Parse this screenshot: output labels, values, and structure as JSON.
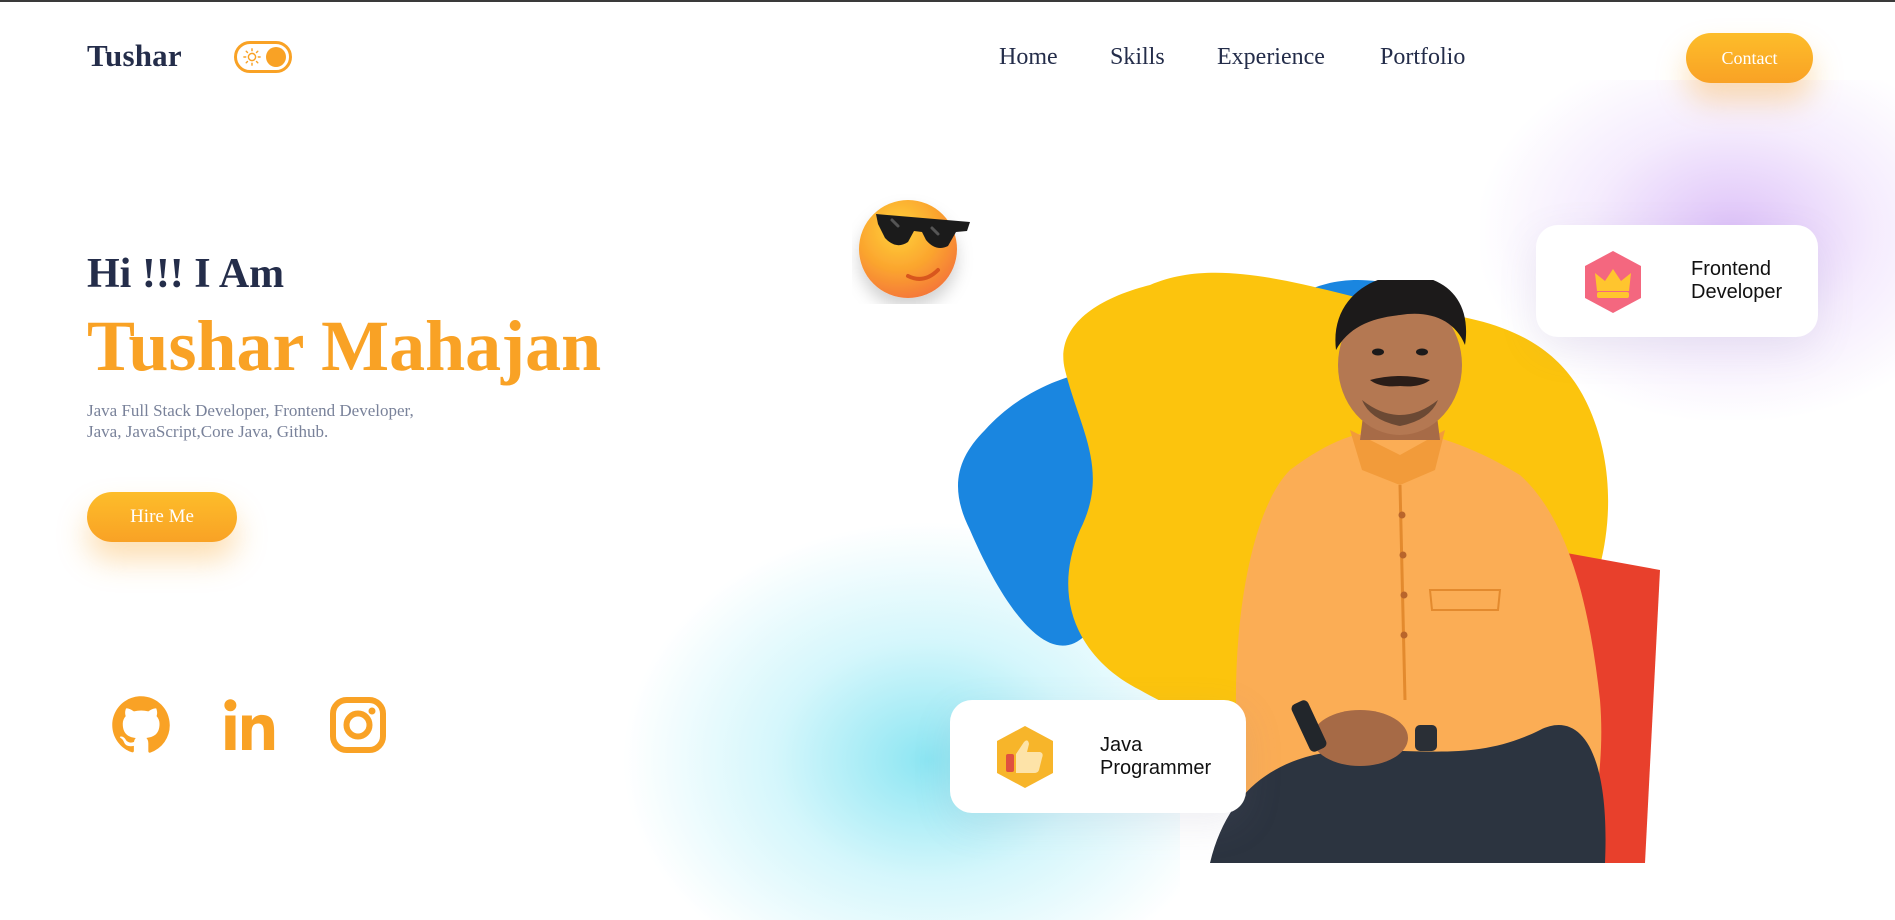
{
  "header": {
    "logo": "Tushar",
    "theme_toggle": {
      "state": "light"
    },
    "nav": [
      {
        "label": "Home"
      },
      {
        "label": "Skills"
      },
      {
        "label": "Experience"
      },
      {
        "label": "Portfolio"
      }
    ],
    "contact_label": "Contact"
  },
  "hero": {
    "greeting": "Hi !!! I Am",
    "name": "Tushar Mahajan",
    "description_line1": "Java Full Stack Developer, Frontend Developer,",
    "description_line2": "Java, JavaScript,Core Java, Github.",
    "hire_label": "Hire Me"
  },
  "socials": [
    {
      "icon": "github-icon"
    },
    {
      "icon": "linkedin-icon"
    },
    {
      "icon": "instagram-icon"
    }
  ],
  "cards": {
    "frontend": {
      "line1": "Frontend",
      "line2": "Developer",
      "icon": "crown-icon"
    },
    "java": {
      "line1": "Java",
      "line2": "Programmer",
      "icon": "thumbs-up-icon"
    }
  },
  "colors": {
    "accent": "#f9a225",
    "heading": "#242d4a",
    "muted": "#79829a",
    "blob_yellow": "#fcc40d",
    "blob_blue": "#1a86e0"
  }
}
